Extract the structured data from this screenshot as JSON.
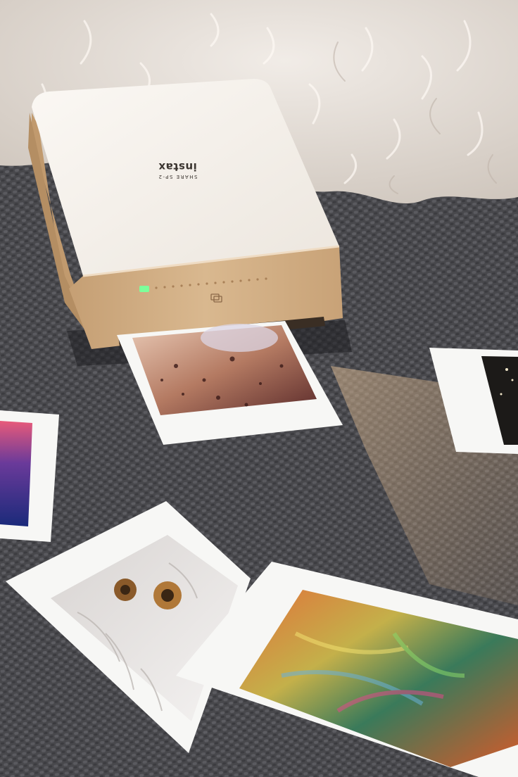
{
  "printer": {
    "brand": "instax",
    "model": "SHARE SP-2",
    "status_light_color": "#7dff9a",
    "body_color": "#f3eee8",
    "trim_color": "#cba77f"
  },
  "colors": {
    "blanket": "#4a4a4e",
    "fur": "#e8e2dc",
    "photo_border": "#f7f7f5"
  }
}
